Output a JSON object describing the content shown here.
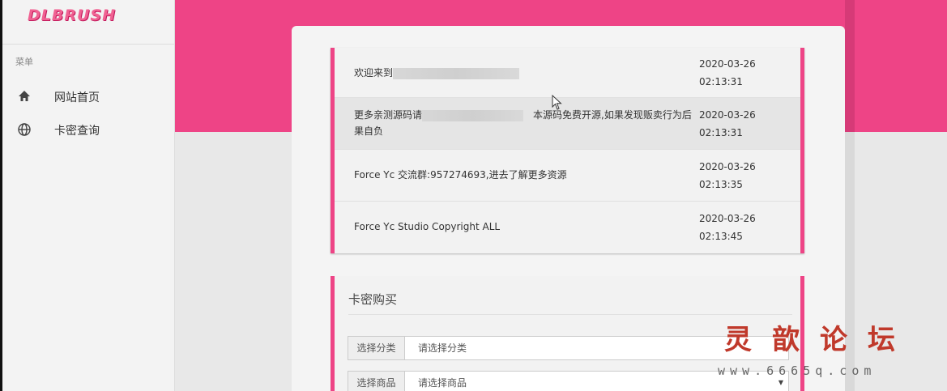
{
  "sidebar": {
    "brand": "DLBRUSH",
    "menu_heading": "菜单",
    "items": [
      {
        "label": "网站首页",
        "icon": "home-icon"
      },
      {
        "label": "卡密查询",
        "icon": "globe-icon"
      }
    ]
  },
  "notices": [
    {
      "text_before": "欢迎来到",
      "text_after": "",
      "time_date": "2020-03-26",
      "time_clock": "02:13:31"
    },
    {
      "text_before": "更多亲测源码请",
      "text_after": "本源码免费开源,如果发现贩卖行为后果自负",
      "time_date": "2020-03-26",
      "time_clock": "02:13:31"
    },
    {
      "text_before": "Force Yc 交流群:957274693,进去了解更多资源",
      "text_after": "",
      "time_date": "2020-03-26",
      "time_clock": "02:13:35"
    },
    {
      "text_before": "Force Yc Studio Copyright ALL",
      "text_after": "",
      "time_date": "2020-03-26",
      "time_clock": "02:13:45"
    }
  ],
  "purchase": {
    "title": "卡密购买",
    "category_label": "选择分类",
    "category_value": "请选择分类",
    "product_label": "选择商品",
    "product_value": "请选择商品"
  },
  "watermark": {
    "title": "灵歆论坛",
    "url": "www.6665q.com"
  },
  "colors": {
    "accent": "#ee4486",
    "brand": "#f06292",
    "watermark": "#c0392b"
  }
}
